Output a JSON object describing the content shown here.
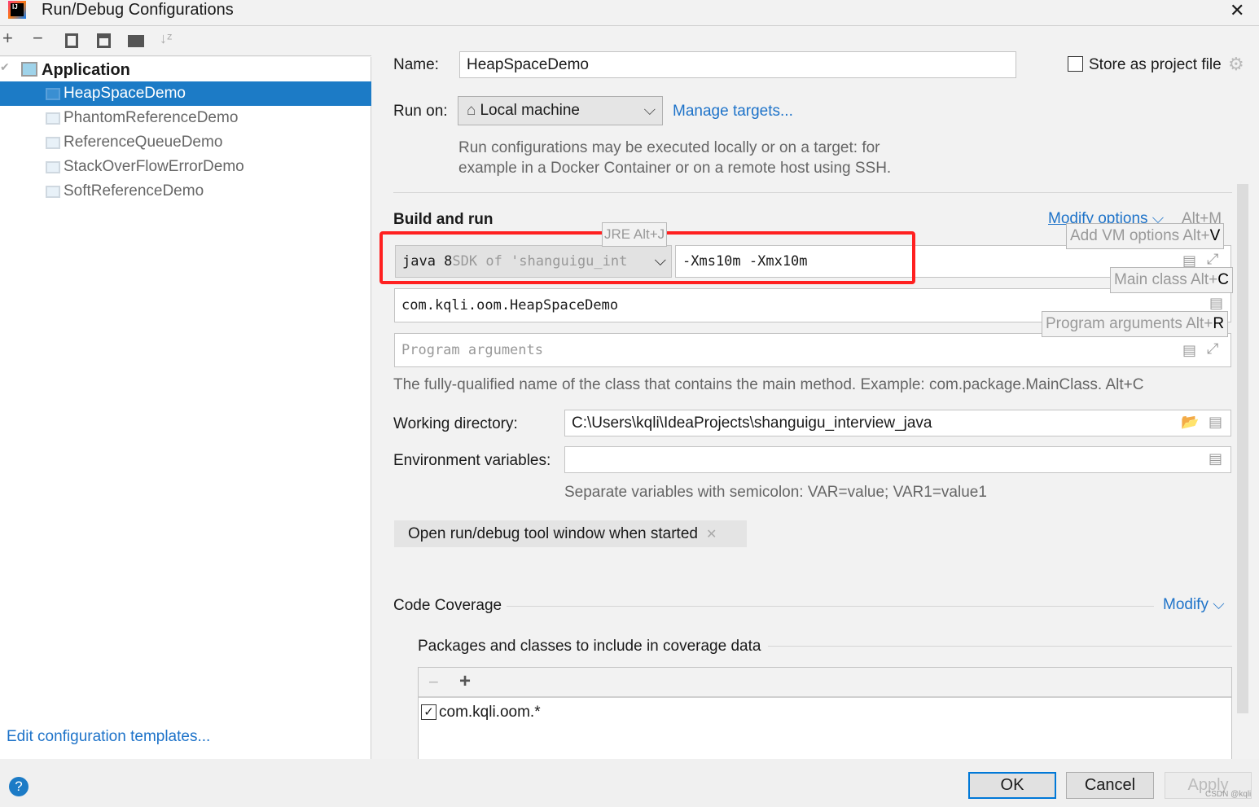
{
  "window": {
    "title": "Run/Debug Configurations",
    "close": "✕"
  },
  "toolbar": {
    "icons": [
      "add-icon",
      "remove-icon",
      "copy-icon",
      "save-icon",
      "new-folder-icon",
      "sort-icon"
    ]
  },
  "tree": {
    "group": "Application",
    "items": [
      "HeapSpaceDemo",
      "PhantomReferenceDemo",
      "ReferenceQueueDemo",
      "StackOverFlowErrorDemo",
      "SoftReferenceDemo"
    ],
    "selected": "HeapSpaceDemo"
  },
  "edit_templates": "Edit configuration templates...",
  "form": {
    "name_label": "Name:",
    "name_value": "HeapSpaceDemo",
    "store_label": "Store as project file",
    "store_checked": false,
    "run_on_label": "Run on:",
    "run_on_value": "Local machine",
    "manage_targets": "Manage targets...",
    "run_on_help": [
      "Run configurations may be executed locally or on a target: for",
      "example in a Docker Container or on a remote host using SSH."
    ],
    "build_title": "Build and run",
    "modify_options": "Modify options",
    "modify_shortcut": "Alt+M",
    "jre_java": "java 8",
    "jre_rest": " SDK of 'shanguigu_int",
    "jre_hint": "JRE Alt+J",
    "vm_options": "-Xms10m -Xmx10m",
    "vm_hint_text": "Add VM options Alt+",
    "vm_hint_key": "V",
    "main_class": "com.kqli.oom.HeapSpaceDemo",
    "main_hint_text": "Main class Alt+",
    "main_hint_key": "C",
    "program_args_placeholder": "Program arguments",
    "args_hint_text": "Program arguments Alt+",
    "args_hint_key": "R",
    "main_help": "The fully-qualified name of the class that contains the main method. Example: com.package.MainClass. Alt+C",
    "workdir_label": "Working directory:",
    "workdir_value": "C:\\Users\\kqli\\IdeaProjects\\shanguigu_interview_java",
    "env_label": "Environment variables:",
    "env_value": "",
    "env_help": "Separate variables with semicolon: VAR=value; VAR1=value1",
    "open_tool_window": "Open run/debug tool window when started",
    "coverage_title": "Code Coverage",
    "coverage_modify": "Modify",
    "packages_title": "Packages and classes to include in coverage data",
    "packages": [
      {
        "name": "com.kqli.oom.*",
        "checked": true
      }
    ]
  },
  "buttons": {
    "ok": "OK",
    "cancel": "Cancel",
    "apply": "Apply"
  },
  "watermark": "CSDN @kqli",
  "colors": {
    "selection": "#1c7bc6",
    "link": "#1e73c9",
    "highlight": "#ff2020"
  }
}
